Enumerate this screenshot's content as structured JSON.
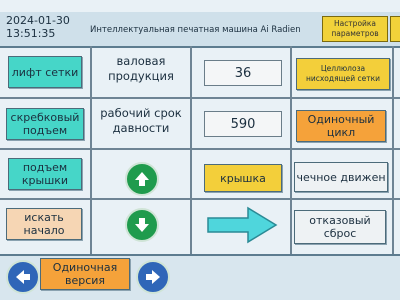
{
  "header": {
    "date": "2024-01-30",
    "time": "13:51:35",
    "title": "Интеллектуальная печатная машина Ai Radien",
    "params_button": "Настройка параметров"
  },
  "row1": {
    "lift_net": "лифт сетки",
    "gross_label": "валовая продукция",
    "gross_value": "36",
    "cellulose_button": "Целлюлоза нисходящей сетки"
  },
  "row2": {
    "scraper_lift": "скребковый подъем",
    "work_period_label": "рабочий срок давности",
    "work_period_value": "590",
    "single_cycle": "Одиночный цикл"
  },
  "row3": {
    "lid_lift": "подъем крышки",
    "lid": "крышка",
    "motion": "чечное движен"
  },
  "row4": {
    "find_start": "искать начало",
    "fault_reset": "отказовый сброс"
  },
  "footer": {
    "single_version": "Одиночная версия"
  }
}
